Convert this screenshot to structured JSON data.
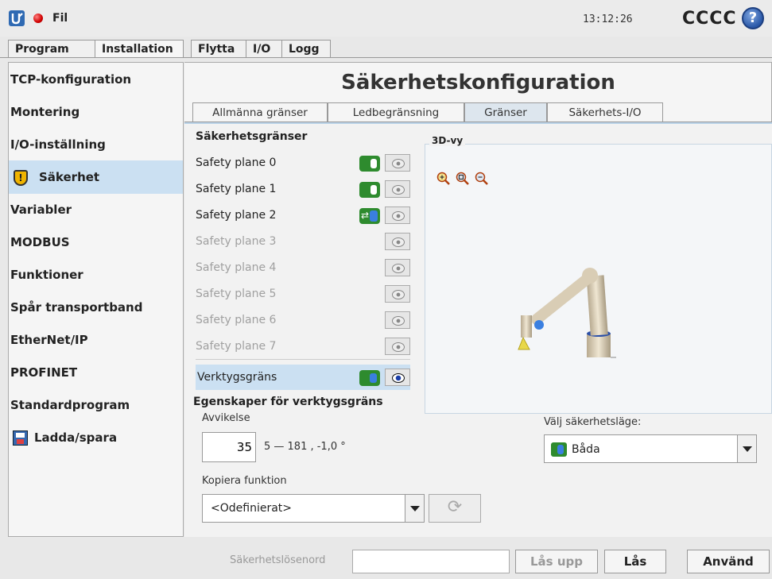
{
  "topbar": {
    "file_menu": "Fil",
    "time": "13:12:26",
    "robot_name": "CCCC",
    "help_glyph": "?"
  },
  "main_tabs": [
    "Program",
    "Installation",
    "Flytta",
    "I/O",
    "Logg"
  ],
  "sidebar": {
    "items": [
      {
        "label": "TCP-konfiguration"
      },
      {
        "label": "Montering"
      },
      {
        "label": "I/O-inställning"
      },
      {
        "label": "Säkerhet",
        "icon": "shield-icon",
        "active": true
      },
      {
        "label": "Variabler"
      },
      {
        "label": "MODBUS"
      },
      {
        "label": "Funktioner"
      },
      {
        "label": "Spår transportband"
      },
      {
        "label": "EtherNet/IP"
      },
      {
        "label": "PROFINET"
      },
      {
        "label": "Standardprogram"
      },
      {
        "label": "Ladda/spara",
        "icon": "floppy-disk-icon"
      }
    ],
    "shield_glyph": "!"
  },
  "content": {
    "title": "Säkerhetskonfiguration",
    "sub_tabs": [
      "Allmänna gränser",
      "Ledbegränsning",
      "Gränser",
      "Säkerhets-I/O"
    ],
    "active_sub_tab": "Gränser",
    "safety_limits_heading": "Säkerhetsgränser",
    "planes": [
      {
        "label": "Safety plane 0",
        "mode": "normal",
        "enabled": true
      },
      {
        "label": "Safety plane 1",
        "mode": "normal",
        "enabled": true
      },
      {
        "label": "Safety plane 2",
        "mode": "trigger-reduced",
        "enabled": true
      },
      {
        "label": "Safety plane 3",
        "mode": "disabled",
        "enabled": false
      },
      {
        "label": "Safety plane 4",
        "mode": "disabled",
        "enabled": false
      },
      {
        "label": "Safety plane 5",
        "mode": "disabled",
        "enabled": false
      },
      {
        "label": "Safety plane 6",
        "mode": "disabled",
        "enabled": false
      },
      {
        "label": "Safety plane 7",
        "mode": "disabled",
        "enabled": false
      }
    ],
    "tool_limit": {
      "label": "Verktygsgräns",
      "mode": "both",
      "visible": true
    },
    "view3d_title": "3D-vy",
    "properties_heading": "Egenskaper för verktygsgräns",
    "deviation_label": "Avvikelse",
    "deviation_value": "35",
    "deviation_range": "5 — 181 , -1,0 °",
    "copy_label": "Kopiera funktion",
    "copy_value": "<Odefinierat>",
    "safety_mode_label": "Välj säkerhetsläge:",
    "safety_mode_value": "Båda",
    "refresh_glyph": "⟳"
  },
  "bottombar": {
    "password_label": "Säkerhetslösenord",
    "unlock": "Lås upp",
    "lock": "Lås",
    "apply": "Använd"
  },
  "colors": {
    "accent_selected": "#cbe0f2",
    "toggle_green": "#2e8b2e",
    "toggle_blue": "#3a7fe0"
  }
}
